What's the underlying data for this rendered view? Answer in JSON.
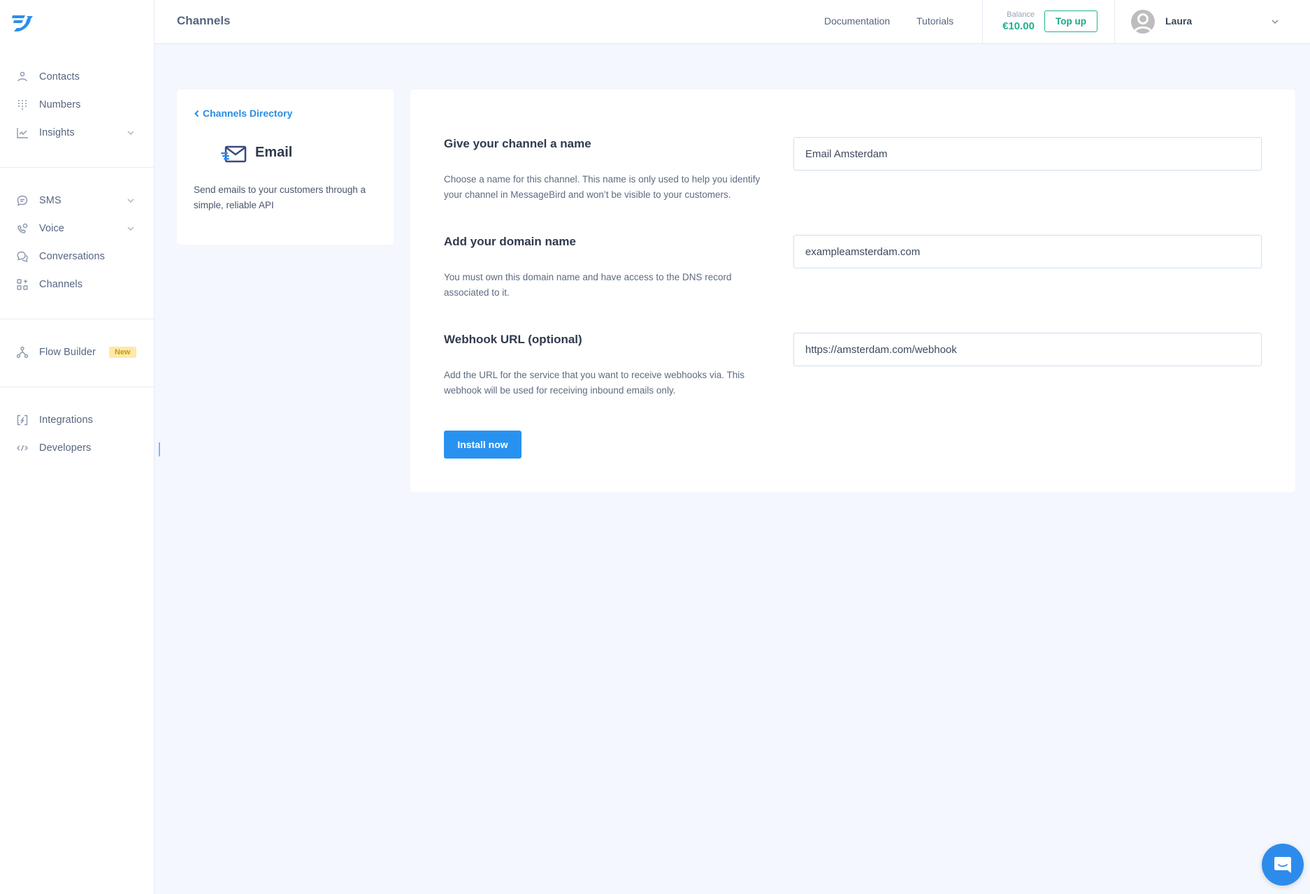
{
  "app": {
    "brand_color": "#2892f0",
    "logo": "messagebird-logo-icon"
  },
  "sidebar": {
    "groups": [
      {
        "items": [
          {
            "label": "Contacts",
            "icon": "person-icon",
            "has_chevron": false
          },
          {
            "label": "Numbers",
            "icon": "dialpad-icon",
            "has_chevron": false
          },
          {
            "label": "Insights",
            "icon": "line-chart-icon",
            "has_chevron": true
          }
        ]
      },
      {
        "items": [
          {
            "label": "SMS",
            "icon": "chat-bubble-icon",
            "has_chevron": true
          },
          {
            "label": "Voice",
            "icon": "phone-icon",
            "has_chevron": true
          },
          {
            "label": "Conversations",
            "icon": "conversations-icon",
            "has_chevron": false
          },
          {
            "label": "Channels",
            "icon": "channels-grid-icon",
            "has_chevron": false
          }
        ]
      },
      {
        "items": [
          {
            "label": "Flow Builder",
            "icon": "flow-icon",
            "has_chevron": false,
            "badge": "New"
          }
        ]
      },
      {
        "items": [
          {
            "label": "Integrations",
            "icon": "integrations-icon",
            "has_chevron": false
          },
          {
            "label": "Developers",
            "icon": "code-icon",
            "has_chevron": false
          }
        ]
      }
    ]
  },
  "header": {
    "title": "Channels",
    "links": [
      "Documentation",
      "Tutorials"
    ],
    "balance_label": "Balance",
    "balance_value": "€10.00",
    "topup_label": "Top up",
    "user_name": "Laura",
    "accent_color": "#23b08f"
  },
  "channel_info": {
    "back_label": "Channels Directory",
    "name": "Email",
    "description": "Send emails to your customers through a simple, reliable API"
  },
  "form": {
    "fields": [
      {
        "title": "Give your channel a name",
        "help": "Choose a name for this channel. This name is only used to help you identify your channel in MessageBird and won’t be visible to your customers.",
        "value": "Email Amsterdam"
      },
      {
        "title": "Add your domain name",
        "help": "You must own this domain name and have access to the DNS record associated to it.",
        "value": "exampleamsterdam.com"
      },
      {
        "title": "Webhook URL (optional)",
        "help": "Add the URL for the service that you want to receive webhooks via. This webhook will be used for receiving inbound emails only.",
        "value": "https://amsterdam.com/webhook"
      }
    ],
    "submit_label": "Install now"
  }
}
